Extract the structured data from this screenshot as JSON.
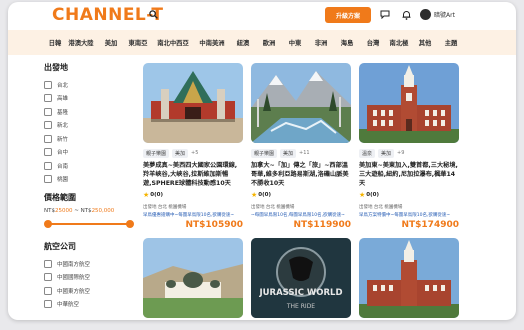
{
  "brand": {
    "logo": "CHANNEL-T",
    "accent": "#f07a1a"
  },
  "header": {
    "upgrade_label": "升級方案",
    "user_name": "暗號Art"
  },
  "nav": [
    "日韓",
    "港澳大陸",
    "美加",
    "東南亞",
    "南北中西亞",
    "中南美洲",
    "紐澳",
    "歐洲",
    "中東",
    "非洲",
    "海島",
    "台灣",
    "南北極",
    "其他",
    "主題"
  ],
  "sidebar": {
    "departure_heading": "出發地",
    "departures": [
      "台北",
      "高雄",
      "基隆",
      "新北",
      "新竹",
      "台中",
      "台南",
      "桃園"
    ],
    "price_heading": "價格範圍",
    "price_prefix": "NT$",
    "price_min": "25000",
    "price_sep": " ~ NT$",
    "price_max": "250,000",
    "price_range_fraction": [
      0.0,
      1.0
    ],
    "airline_heading": "航空公司",
    "airlines": [
      "中國南方航空",
      "中國國際航空",
      "中國東方航空",
      "中華航空"
    ]
  },
  "cards": [
    {
      "tags": [
        "親子樂園",
        "美加"
      ],
      "more": "+5",
      "title": "美夢成真~美西四大國家公園環線,羚羊峽谷,大峽谷,拉斯維加斯暢遊,SPHERE球體科技動感10天",
      "rating": "0(0)",
      "depart": "出發地 台北 桃園機場",
      "note": "早鳥優惠搶購中~每團早鳥限10名,欲購從速~",
      "price": "NT$105900"
    },
    {
      "tags": [
        "親子樂園",
        "美加"
      ],
      "more": "+11",
      "title": "加拿大~「加」傳之「旅」~西部溫哥華,維多利亞路易斯湖,洛磯山脈美不勝收10天",
      "rating": "0(0)",
      "depart": "出發地 台北 桃園機場",
      "note": "~每團早鳥限10名,每團早鳥限10名,欲購從速~",
      "price": "NT$119900"
    },
    {
      "tags": [
        "溫泉",
        "美加"
      ],
      "more": "+9",
      "title": "美加東~美東加入,雙首都,三大秘境,三大遊船,紐約,尼加拉瀑布,楓華14天",
      "rating": "0(0)",
      "depart": "出發地 台北 桃園機場",
      "note": "早鳥方案特價中~每團早鳥限10名,欲購從速~",
      "price": "NT$174900"
    }
  ],
  "second_row": {
    "movie_title": "JURASSIC WORLD",
    "movie_sub": "THE RIDE"
  }
}
